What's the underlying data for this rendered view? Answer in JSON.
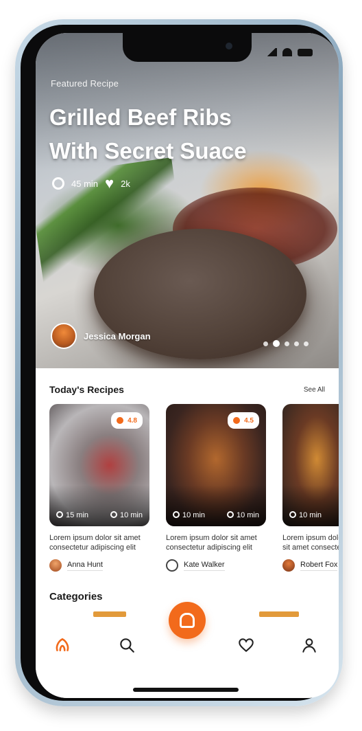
{
  "hero": {
    "kicker": "Featured Recipe",
    "title_line1": "Grilled Beef Ribs",
    "title_line2": "With Secret Suace",
    "time": "45 min",
    "likes": "2k",
    "author_name": "Jessica Morgan",
    "slide_count": 5,
    "active_slide": 2
  },
  "todays_recipes": {
    "title": "Today's Recipes",
    "see_all": "See All",
    "cards": [
      {
        "badge": "4.8",
        "time": "15 min",
        "servings": "10 min",
        "description": "Lorem ipsum dolor sit amet consectetur adipiscing elit",
        "author": "Anna Hunt"
      },
      {
        "badge": "4.5",
        "time": "10 min",
        "servings": "10 min",
        "description": "Lorem ipsum dolor sit amet consectetur adipiscing elit",
        "author": "Kate Walker"
      },
      {
        "badge": "",
        "time": "10 min",
        "servings": "",
        "description": "Lorem ipsum dolor sit amet consectetur",
        "author": "Robert Fox"
      }
    ]
  },
  "categories": {
    "title": "Categories"
  },
  "tabbar": {
    "items": [
      "home",
      "search",
      "cook",
      "favorites",
      "profile"
    ]
  },
  "colors": {
    "accent": "#f26a1b",
    "text": "#1a1a1a"
  }
}
